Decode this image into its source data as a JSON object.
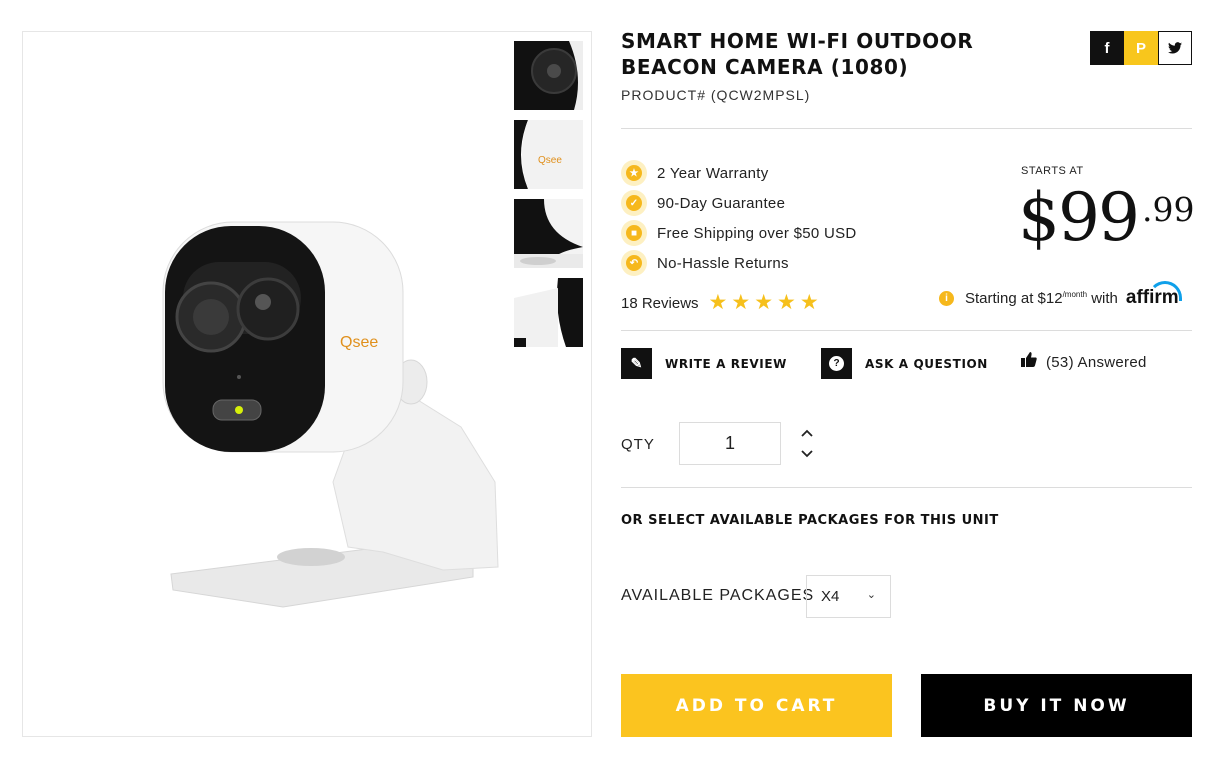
{
  "product": {
    "title": "SMART HOME WI-FI OUTDOOR BEACON CAMERA (1080)",
    "product_number": "PRODUCT# (QCW2MPSL)",
    "brand_logo_text": "Qsee HD"
  },
  "share": {
    "facebook_icon": "facebook-icon",
    "pinterest_icon": "pinterest-icon",
    "twitter_icon": "twitter-icon"
  },
  "features": [
    {
      "label": "2 Year Warranty",
      "icon": "award-icon"
    },
    {
      "label": "90-Day Guarantee",
      "icon": "check-badge-icon"
    },
    {
      "label": "Free Shipping over $50 USD",
      "icon": "box-icon"
    },
    {
      "label": "No-Hassle Returns",
      "icon": "return-arrow-icon"
    }
  ],
  "pricing": {
    "starts_at": "STARTS AT",
    "price_main": "$99",
    "price_cents": ".99"
  },
  "reviews": {
    "label": "18 Reviews",
    "rating": 5,
    "max": 5
  },
  "affirm": {
    "text_prefix": "Starting at $12",
    "text_suffix_sup": "/month",
    "text_with": "with",
    "logo": "affirm"
  },
  "actions": {
    "write_review": "WRITE A REVIEW",
    "ask_question": "ASK A QUESTION",
    "answered": "(53) Answered"
  },
  "quantity": {
    "label": "QTY",
    "value": "1"
  },
  "packages": {
    "heading": "OR SELECT AVAILABLE PACKAGES FOR THIS UNIT",
    "label": "AVAILABLE PACKAGES",
    "selected": "X4"
  },
  "buttons": {
    "add_to_cart": "ADD TO CART",
    "buy_now": "BUY IT NOW"
  },
  "colors": {
    "accent": "#fbc41f",
    "dark": "#000000",
    "affirm_blue": "#0fa0ea"
  }
}
